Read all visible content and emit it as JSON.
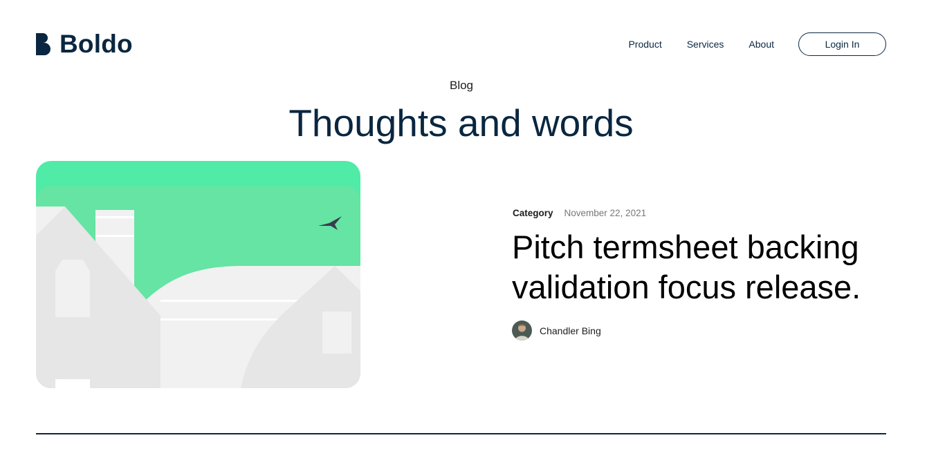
{
  "brand": {
    "name": "Boldo",
    "logo_icon": "boldo-logo-icon",
    "color": "#0A2640"
  },
  "nav": {
    "items": [
      {
        "label": "Product"
      },
      {
        "label": "Services"
      },
      {
        "label": "About"
      }
    ],
    "login_label": "Login In"
  },
  "hero": {
    "eyebrow": "Blog",
    "title": "Thoughts and words"
  },
  "featured_post": {
    "category": "Category",
    "date": "November 22, 2021",
    "title": "Pitch termsheet backing validation focus release.",
    "author": {
      "name": "Chandler Bing",
      "avatar_icon": "author-avatar"
    },
    "image_icon": "house-illustration",
    "colors": {
      "sky": "#65E4A3",
      "sky_top": "#50EBA6",
      "house_light": "#F1F1F1",
      "house_shadow": "#E6E6E6",
      "bird": "#3A3A4E"
    }
  }
}
